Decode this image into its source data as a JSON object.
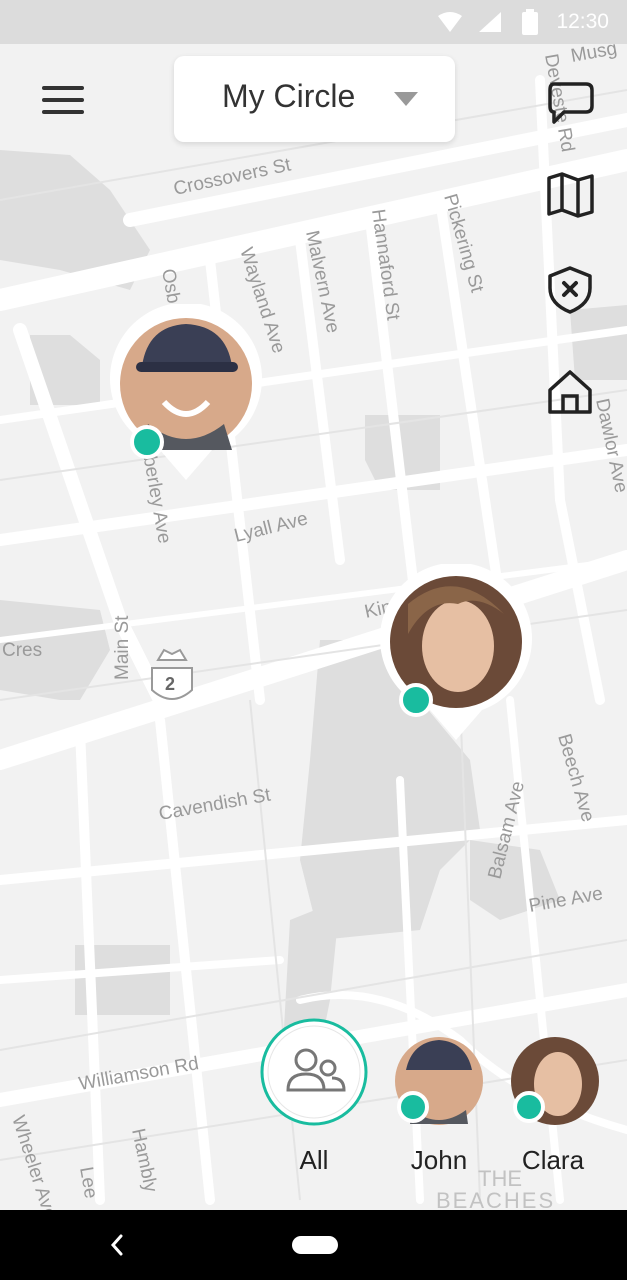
{
  "status_bar": {
    "time": "12:30",
    "icons": [
      "wifi-icon",
      "signal-icon",
      "battery-icon"
    ]
  },
  "header": {
    "title": "My Circle",
    "menu_icon": "menu-icon",
    "dropdown_icon": "caret-down-icon"
  },
  "side_actions": [
    {
      "name": "chat-icon"
    },
    {
      "name": "map-icon"
    },
    {
      "name": "shield-icon"
    },
    {
      "name": "home-icon"
    }
  ],
  "map": {
    "streets": [
      "Crossovers St",
      "Wayland Ave",
      "Malvern Ave",
      "Hannaford St",
      "Pickering St",
      "Kimberley Ave",
      "Lyall Ave",
      "Main St",
      "Cres",
      "Cavendish St",
      "Balsam Ave",
      "Beech Ave",
      "Pine Ave",
      "Williamson Rd",
      "Wheeler Ave",
      "Lee",
      "Hambly",
      "Kingston Rd",
      "Osborne",
      "Dawlor Ave",
      "Deveste Rd",
      "Musg",
      "THE",
      "BEACHES"
    ],
    "route_badge": "2"
  },
  "bottom_bar": {
    "all_label": "All",
    "members": [
      {
        "name": "John",
        "status_color": "#19bc9f"
      },
      {
        "name": "Clara",
        "status_color": "#19bc9f"
      }
    ]
  },
  "colors": {
    "accent": "#19bc9f",
    "map_bg": "#f2f2f2"
  }
}
